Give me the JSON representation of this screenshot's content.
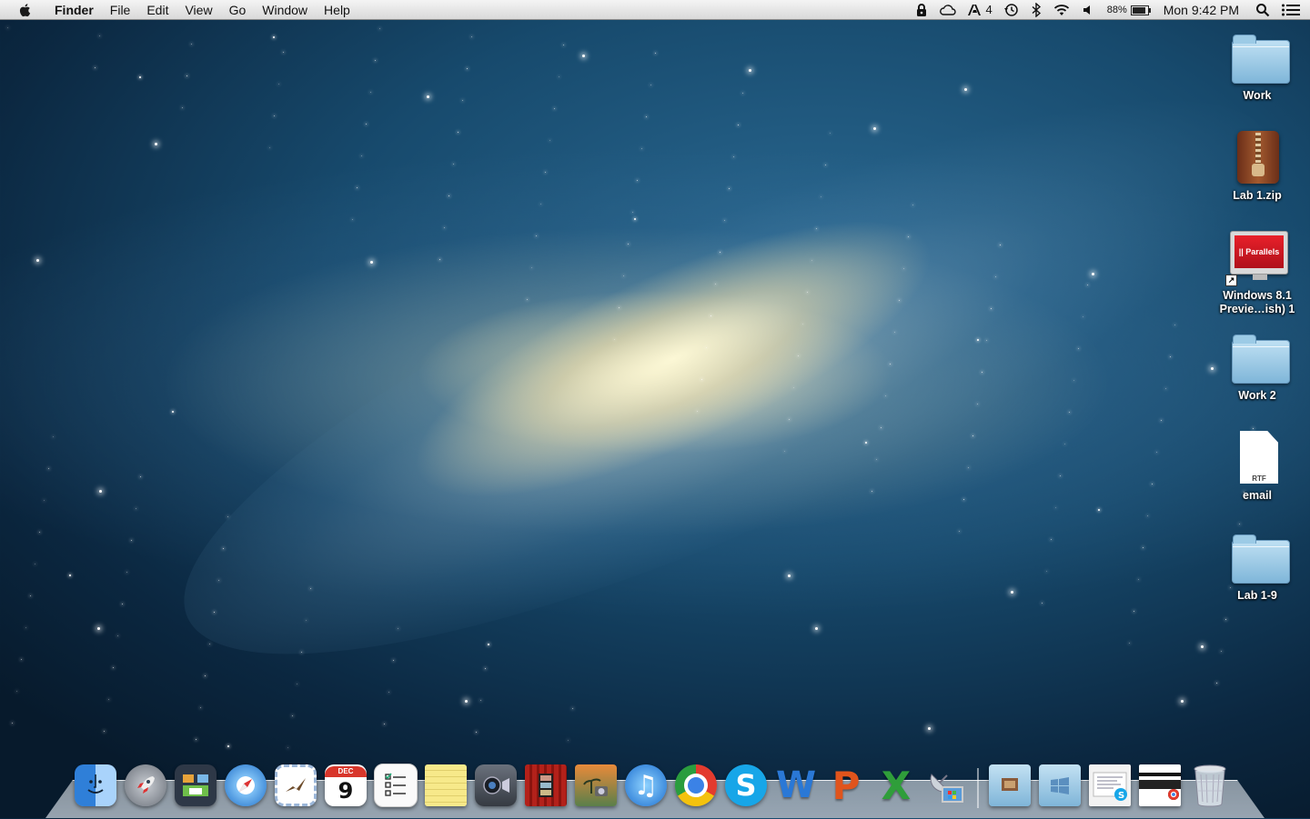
{
  "menubar": {
    "app_name": "Finder",
    "menus": [
      "File",
      "Edit",
      "View",
      "Go",
      "Window",
      "Help"
    ],
    "status": {
      "notification_count": "4",
      "battery_percent": "88%",
      "battery_level": 0.88,
      "clock": "Mon 9:42 PM"
    },
    "icons": [
      "apple-logo-icon",
      "lock-icon",
      "cloud-icon",
      "adobe-icon",
      "time-machine-icon",
      "bluetooth-icon",
      "wifi-icon",
      "volume-icon",
      "battery-icon",
      "spotlight-icon",
      "notification-center-icon"
    ]
  },
  "desktop": {
    "icons": [
      {
        "label": "Work",
        "kind": "folder"
      },
      {
        "label": "Lab 1.zip",
        "kind": "zip"
      },
      {
        "label": "Windows 8.1\nPrevie…ish) 1",
        "kind": "parallels",
        "badge": "|| Parallels"
      },
      {
        "label": "Work 2",
        "kind": "folder"
      },
      {
        "label": "email",
        "kind": "rtf",
        "badge": "RTF"
      },
      {
        "label": "Lab 1-9",
        "kind": "folder"
      }
    ]
  },
  "dock": {
    "apps": [
      {
        "name": "Finder",
        "icon": "finder-icon",
        "color": "#5aa8f0"
      },
      {
        "name": "Launchpad",
        "icon": "rocket-icon",
        "color": "#8a8f99"
      },
      {
        "name": "Mission Control",
        "icon": "mission-control-icon",
        "color": "#3c4a5c"
      },
      {
        "name": "Safari",
        "icon": "compass-icon",
        "color": "#3b8fe0"
      },
      {
        "name": "Mail",
        "icon": "mail-stamp-icon",
        "color": "#6b95c9"
      },
      {
        "name": "Calendar",
        "icon": "calendar-icon",
        "color": "#ffffff",
        "month": "DEC",
        "day": "9"
      },
      {
        "name": "Reminders",
        "icon": "checklist-icon",
        "color": "#f4f4f4"
      },
      {
        "name": "Notes",
        "icon": "notepad-icon",
        "color": "#f5e27a"
      },
      {
        "name": "FaceTime",
        "icon": "camera-icon",
        "color": "#4a4f58"
      },
      {
        "name": "Photo Booth",
        "icon": "photo-booth-icon",
        "color": "#b3211a"
      },
      {
        "name": "iPhoto",
        "icon": "iphoto-icon",
        "color": "#6a7c8c"
      },
      {
        "name": "iTunes",
        "icon": "music-note-icon",
        "color": "#2f8ee8"
      },
      {
        "name": "Google Chrome",
        "icon": "chrome-icon",
        "color": "#e33b2e"
      },
      {
        "name": "Skype",
        "icon": "skype-icon",
        "color": "#17a6e8"
      },
      {
        "name": "Microsoft Word",
        "icon": "word-icon",
        "color": "#2a78d6"
      },
      {
        "name": "Microsoft PowerPoint",
        "icon": "powerpoint-icon",
        "color": "#e0541c"
      },
      {
        "name": "Microsoft Excel",
        "icon": "excel-icon",
        "color": "#2f9e3a"
      },
      {
        "name": "Remote Desktop",
        "icon": "satellite-dish-icon",
        "color": "#9aa6b2"
      }
    ],
    "right_items": [
      {
        "name": "Applications",
        "icon": "applications-folder-icon"
      },
      {
        "name": "Windows Folder",
        "icon": "windows-folder-icon"
      },
      {
        "name": "Downloads Stack",
        "icon": "document-stack-icon"
      },
      {
        "name": "Chrome Window",
        "icon": "window-thumbnail-icon"
      },
      {
        "name": "Trash",
        "icon": "trash-icon"
      }
    ]
  }
}
